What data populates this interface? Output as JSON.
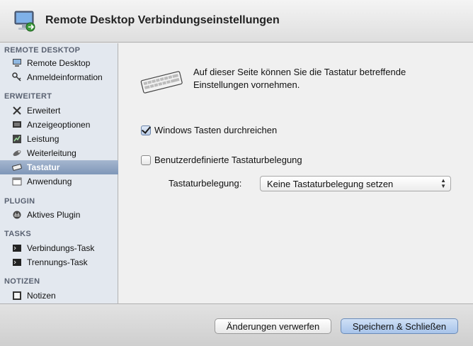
{
  "window": {
    "title": "Remote Desktop Verbindungseinstellungen",
    "app_icon": "remote-desktop-monitor-icon"
  },
  "sidebar": {
    "sections": [
      {
        "title": "REMOTE DESKTOP",
        "items": [
          {
            "label": "Remote Desktop",
            "icon": "computer-icon"
          },
          {
            "label": "Anmeldeinformation",
            "icon": "key-icon"
          }
        ]
      },
      {
        "title": "ERWEITERT",
        "items": [
          {
            "label": "Erweitert",
            "icon": "tools-icon"
          },
          {
            "label": "Anzeigeoptionen",
            "icon": "display-icon"
          },
          {
            "label": "Leistung",
            "icon": "performance-icon"
          },
          {
            "label": "Weiterleitung",
            "icon": "redirect-icon"
          },
          {
            "label": "Tastatur",
            "icon": "keyboard-icon",
            "selected": true
          },
          {
            "label": "Anwendung",
            "icon": "application-icon"
          }
        ]
      },
      {
        "title": "PLUGIN",
        "items": [
          {
            "label": "Aktives Plugin",
            "icon": "plugin-icon"
          }
        ]
      },
      {
        "title": "TASKS",
        "items": [
          {
            "label": "Verbindungs-Task",
            "icon": "terminal-icon"
          },
          {
            "label": "Trennungs-Task",
            "icon": "terminal-icon"
          }
        ]
      },
      {
        "title": "NOTIZEN",
        "items": [
          {
            "label": "Notizen",
            "icon": "notes-icon"
          }
        ]
      }
    ]
  },
  "main": {
    "description": "Auf dieser Seite können Sie die Tastatur betreffende Einstellungen vornehmen.",
    "windows_keys": {
      "label": "Windows Tasten durchreichen",
      "checked": true
    },
    "custom_layout": {
      "label": "Benutzerdefinierte Tastaturbelegung",
      "checked": false
    },
    "layout_select": {
      "label": "Tastaturbelegung:",
      "value": "Keine Tastaturbelegung setzen"
    }
  },
  "footer": {
    "discard_label": "Änderungen verwerfen",
    "save_label": "Speichern & Schließen"
  },
  "colors": {
    "sidebar_bg": "#e3e8ef",
    "selected_item": "#8fa5c6",
    "primary_button": "#b8cfee"
  }
}
